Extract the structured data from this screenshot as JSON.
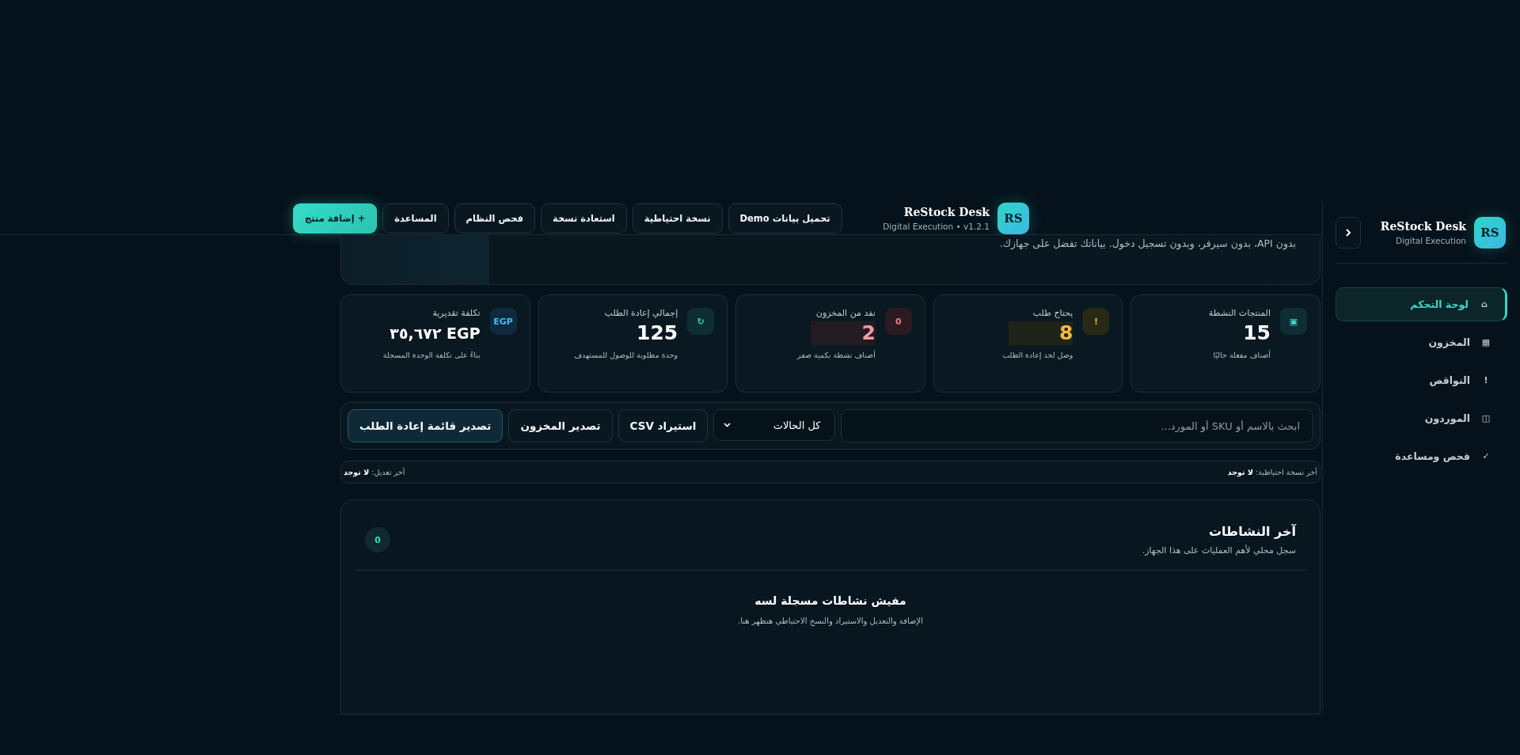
{
  "sidebar": {
    "logo": "RS",
    "title": "ReStock Desk",
    "subtitle": "Digital Execution",
    "items": [
      {
        "icon": "⌂",
        "label": "لوحة التحكم",
        "selected": true
      },
      {
        "icon": "▦",
        "label": "المخزون",
        "selected": false
      },
      {
        "icon": "!",
        "label": "النواقص",
        "selected": false
      },
      {
        "icon": "◫",
        "label": "الموردون",
        "selected": false
      },
      {
        "icon": "✓",
        "label": "فحص ومساعدة",
        "selected": false
      }
    ]
  },
  "topbar": {
    "logo": "RS",
    "title": "ReStock Desk",
    "subtitle": "Digital Execution • v1.2.1",
    "buttons": [
      {
        "label": "تحميل بيانات Demo",
        "kind": "plain"
      },
      {
        "label": "نسخة احتياطية",
        "kind": "plain"
      },
      {
        "label": "استعادة نسخة",
        "kind": "plain"
      },
      {
        "label": "فحص النظام",
        "kind": "plain"
      },
      {
        "label": "المساعدة",
        "kind": "plain"
      },
      {
        "label": "+ إضافة منتج",
        "kind": "primary"
      }
    ]
  },
  "hero": {
    "text": "بدون API، بدون سيرفر، وبدون تسجيل دخول. بياناتك تفضل على جهازك."
  },
  "stats": [
    {
      "icon": "▣",
      "label": "المنتجات النشطة",
      "value": "15",
      "note": "أصناف مفعلة حاليًا",
      "kind": "normal"
    },
    {
      "icon": "!",
      "label": "يحتاج طلب",
      "value": "8",
      "note": "وصل لحد إعادة الطلب",
      "kind": "warning"
    },
    {
      "icon": "0",
      "label": "نفد من المخزون",
      "value": "2",
      "note": "أصناف نشطة بكمية صفر",
      "kind": "danger"
    },
    {
      "icon": "↻",
      "label": "إجمالي إعادة الطلب",
      "value": "125",
      "note": "وحدة مطلوبة للوصول للمستهدف",
      "kind": "normal"
    },
    {
      "icon": "EGP",
      "label": "تكلفة تقديرية",
      "value": "EGP ٣٥,٦٧٢",
      "note": "بناءً على تكلفة الوحدة المسجلة",
      "kind": "money"
    }
  ],
  "toolbar": {
    "search": {
      "placeholder": "ابحث بالاسم أو SKU أو المورد..."
    },
    "filter": {
      "value": "كل الحالات"
    },
    "buttons": [
      {
        "label": "استيراد CSV",
        "kind": "plain"
      },
      {
        "label": "تصدير المخزون",
        "kind": "plain"
      },
      {
        "label": "تصدير قائمة إعادة الطلب",
        "kind": "accent"
      }
    ]
  },
  "status_bar": {
    "backup": "آخر نسخة احتياطية: **لا توجد**",
    "modified": "آخر تعديل: **لا توجد**"
  },
  "activity": {
    "title": "آخر النشاطات",
    "subtitle": "سجل محلي لأهم العمليات على هذا الجهاز.",
    "count": "0",
    "empty_title": "مفيش نشاطات مسجلة لسه",
    "empty_text": "الإضافة والتعديل والاستيراد والنسخ الاحتياطي هتظهر هنا."
  }
}
